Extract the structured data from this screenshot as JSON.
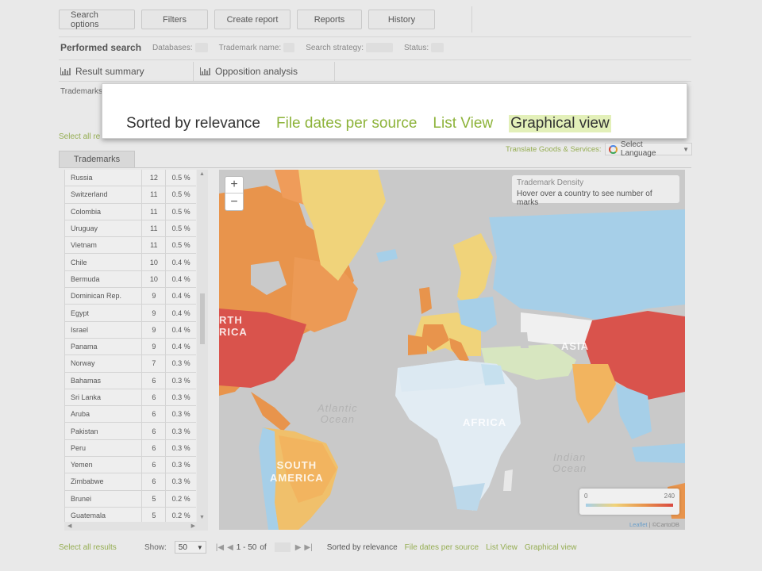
{
  "toolbar": {
    "buttons": [
      "Search options",
      "Filters",
      "Create report",
      "Reports",
      "History"
    ]
  },
  "performed_search": {
    "title": "Performed search",
    "fields": [
      "Databases:",
      "Trademark name:",
      "Search strategy:",
      "Status:"
    ]
  },
  "subtabs": [
    "Result summary",
    "Opposition analysis"
  ],
  "trademarks_label": "Trademarks",
  "select_all_top": "Select all re",
  "popup": {
    "sort_options": [
      "Sorted by relevance",
      "File dates per source",
      "List View",
      "Graphical view"
    ]
  },
  "translate": {
    "label": "Translate Goods & Services:",
    "select": "Select Language"
  },
  "list_tab": "Trademarks",
  "countries": [
    {
      "name": "Russia",
      "count": "12",
      "pct": "0.5 %"
    },
    {
      "name": "Switzerland",
      "count": "11",
      "pct": "0.5 %"
    },
    {
      "name": "Colombia",
      "count": "11",
      "pct": "0.5 %"
    },
    {
      "name": "Uruguay",
      "count": "11",
      "pct": "0.5 %"
    },
    {
      "name": "Vietnam",
      "count": "11",
      "pct": "0.5 %"
    },
    {
      "name": "Chile",
      "count": "10",
      "pct": "0.4 %"
    },
    {
      "name": "Bermuda",
      "count": "10",
      "pct": "0.4 %"
    },
    {
      "name": "Dominican Rep.",
      "count": "9",
      "pct": "0.4 %"
    },
    {
      "name": "Egypt",
      "count": "9",
      "pct": "0.4 %"
    },
    {
      "name": "Israel",
      "count": "9",
      "pct": "0.4 %"
    },
    {
      "name": "Panama",
      "count": "9",
      "pct": "0.4 %"
    },
    {
      "name": "Norway",
      "count": "7",
      "pct": "0.3 %"
    },
    {
      "name": "Bahamas",
      "count": "6",
      "pct": "0.3 %"
    },
    {
      "name": "Sri Lanka",
      "count": "6",
      "pct": "0.3 %"
    },
    {
      "name": "Aruba",
      "count": "6",
      "pct": "0.3 %"
    },
    {
      "name": "Pakistan",
      "count": "6",
      "pct": "0.3 %"
    },
    {
      "name": "Peru",
      "count": "6",
      "pct": "0.3 %"
    },
    {
      "name": "Yemen",
      "count": "6",
      "pct": "0.3 %"
    },
    {
      "name": "Zimbabwe",
      "count": "6",
      "pct": "0.3 %"
    },
    {
      "name": "Brunei",
      "count": "5",
      "pct": "0.2 %"
    },
    {
      "name": "Guatemala",
      "count": "5",
      "pct": "0.2 %"
    }
  ],
  "map": {
    "zoom_in": "+",
    "zoom_out": "−",
    "info_title": "Trademark Density",
    "info_text": "Hover over a country to see number of marks",
    "legend_min": "0",
    "legend_max": "240",
    "attribution_link": "Leaflet",
    "attribution_rest": " | ©CartoDB",
    "labels": {
      "north_america": "RTH\nRICA",
      "atlantic": "Atlantic\nOcean",
      "africa": "AFRICA",
      "asia": "ASIA",
      "south_america": "SOUTH\nAMERICA",
      "indian": "Indian\nOcean"
    },
    "colors": {
      "ocean": "#c9c9c9",
      "low": "#a6cfe8",
      "mid": "#f0d37a",
      "high": "#e8944c",
      "max": "#d94841"
    }
  },
  "footer": {
    "select_all": "Select all results",
    "show_label": "Show:",
    "per_page": "50",
    "range": "1 - 50",
    "of": "of",
    "sorted": "Sorted by relevance",
    "links": [
      "File dates per source",
      "List View",
      "Graphical view"
    ]
  }
}
